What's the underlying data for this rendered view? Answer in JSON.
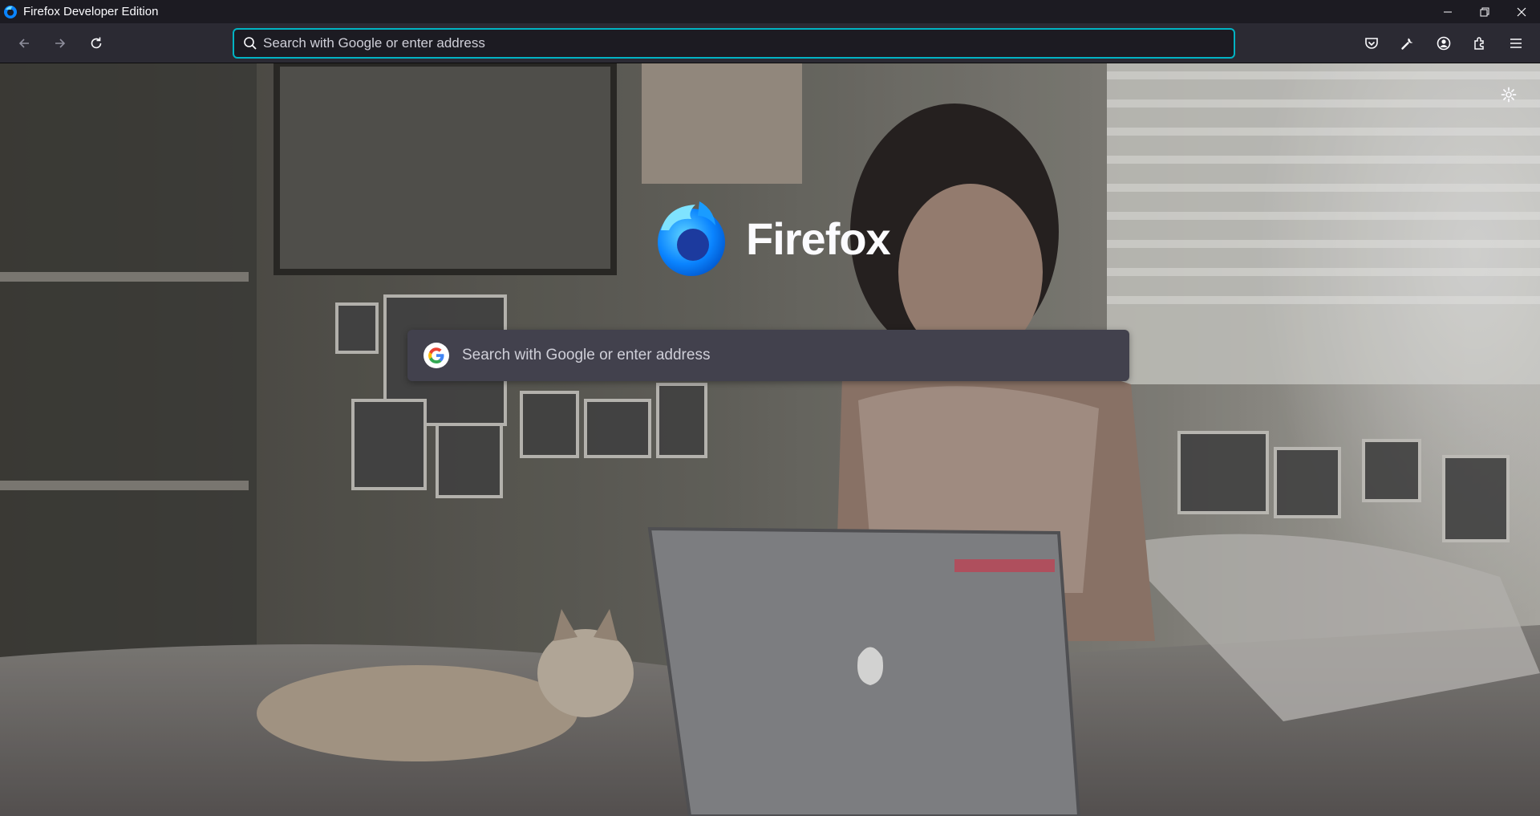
{
  "window": {
    "title": "Firefox Developer Edition",
    "controls": [
      "minimize-icon",
      "restore-icon",
      "close-icon"
    ]
  },
  "navbar": {
    "back_icon": "back-arrow-icon",
    "forward_icon": "forward-arrow-icon",
    "reload_icon": "reload-icon",
    "urlbar": {
      "placeholder": "Search with Google or enter address",
      "value": ""
    },
    "toolbar_icons": [
      "pocket-icon",
      "wrench-icon",
      "account-icon",
      "extensions-icon",
      "hamburger-menu-icon"
    ]
  },
  "newtab": {
    "brand_name": "Firefox",
    "search": {
      "placeholder": "Search with Google or enter address",
      "engine_icon": "google-g-icon"
    },
    "settings_icon": "gear-icon"
  },
  "colors": {
    "titlebar": "#1c1b22",
    "toolbar": "#2b2a33",
    "focus_ring": "#00b3c3",
    "search_box": "#42414d",
    "text": "#fbfbfe"
  }
}
